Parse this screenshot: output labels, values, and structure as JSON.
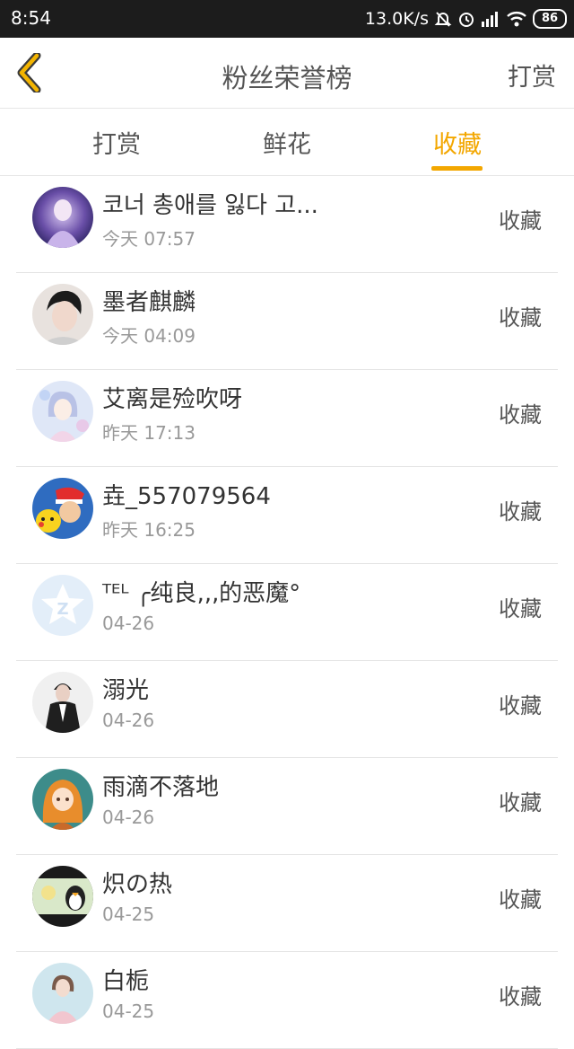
{
  "status": {
    "time": "8:54",
    "speed": "13.0K/s",
    "battery": "86"
  },
  "header": {
    "title": "粉丝荣誉榜",
    "action": "打赏"
  },
  "tabs": [
    {
      "label": "打赏",
      "active": false
    },
    {
      "label": "鲜花",
      "active": false
    },
    {
      "label": "收藏",
      "active": true
    }
  ],
  "fans": [
    {
      "name": "코너 총애를 잃다 고...",
      "time": "今天 07:57",
      "action": "收藏"
    },
    {
      "name": "墨者麒麟",
      "time": "今天 04:09",
      "action": "收藏"
    },
    {
      "name": "艾离是殓吹呀",
      "time": "昨天 17:13",
      "action": "收藏"
    },
    {
      "name": "垚_557079564",
      "time": "昨天 16:25",
      "action": "收藏"
    },
    {
      "name": "ᵀᴱᴸ ╭纯良‚‚‚的恶魔°",
      "time": "04-26",
      "action": "收藏"
    },
    {
      "name": "溺光",
      "time": "04-26",
      "action": "收藏"
    },
    {
      "name": "雨滴不落地",
      "time": "04-26",
      "action": "收藏"
    },
    {
      "name": "炽の热",
      "time": "04-25",
      "action": "收藏"
    },
    {
      "name": "白栀",
      "time": "04-25",
      "action": "收藏"
    }
  ]
}
